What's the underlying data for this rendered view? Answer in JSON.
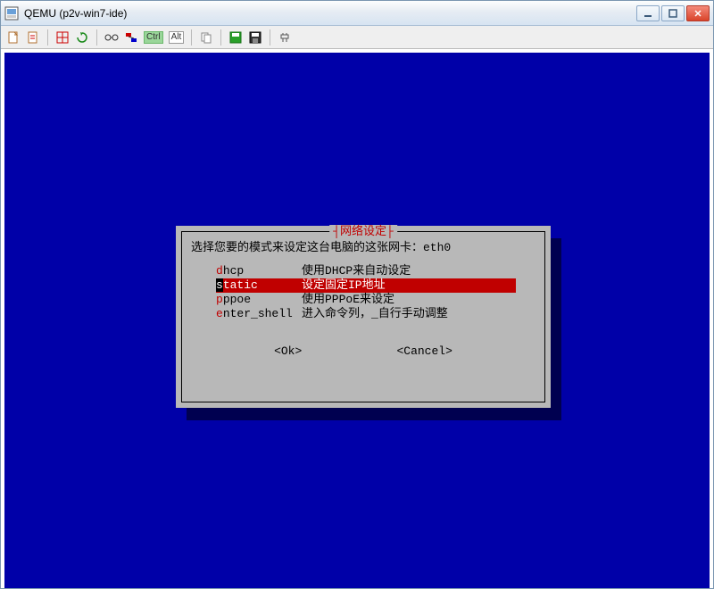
{
  "window": {
    "title": "QEMU (p2v-win7-ide)"
  },
  "toolbar": {
    "ctrl_label": "Ctrl",
    "alt_label": "Alt"
  },
  "dialog": {
    "title": "网络设定",
    "prompt": "选择您要的模式来设定这台电脑的这张网卡：eth0",
    "options": [
      {
        "key": "dhcp",
        "hot": "d",
        "rest": "hcp",
        "desc": "使用DHCP来自动设定",
        "selected": false
      },
      {
        "key": "static",
        "hot": "s",
        "rest": "tatic",
        "desc": "设定固定IP地址",
        "selected": true
      },
      {
        "key": "pppoe",
        "hot": "p",
        "rest": "ppoe",
        "desc": "使用PPPoE来设定",
        "selected": false
      },
      {
        "key": "enter_shell",
        "hot": "e",
        "rest": "nter_shell",
        "desc": "进入命令列，_自行手动调整",
        "selected": false
      }
    ],
    "ok_label": "<Ok>",
    "cancel_label": "<Cancel>"
  }
}
